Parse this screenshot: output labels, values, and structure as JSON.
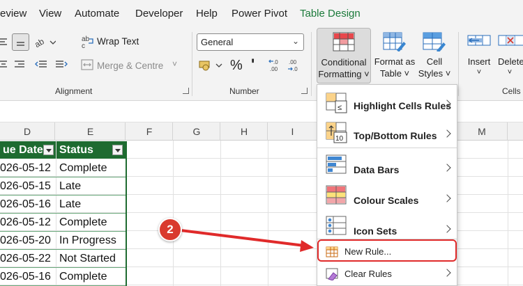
{
  "menu_tabs": [
    {
      "label": "eview"
    },
    {
      "label": "View"
    },
    {
      "label": "Automate"
    },
    {
      "label": "Developer"
    },
    {
      "label": "Help"
    },
    {
      "label": "Power Pivot"
    },
    {
      "label": "Table Design"
    }
  ],
  "ribbon": {
    "alignment": {
      "wrap_text": "Wrap Text",
      "merge_centre": "Merge & Centre",
      "group_label": "Alignment"
    },
    "number": {
      "format_value": "General",
      "percent_symbol": "%",
      "comma_symbol": "'",
      "increase_decimal": "←.0\n.00",
      "decrease_decimal": ".00\n→.0",
      "group_label": "Number"
    },
    "styles": {
      "conditional_formatting": [
        "Conditional",
        "Formatting ˅"
      ],
      "format_as_table": [
        "Format as",
        "Table ˅"
      ],
      "cell_styles": [
        "Cell",
        "Styles ˅"
      ]
    },
    "cells": {
      "insert": "Insert",
      "delete": "Delete",
      "group_label": "Cells"
    }
  },
  "grid": {
    "column_headers": [
      "D",
      "E",
      "F",
      "G",
      "H",
      "I",
      "M"
    ],
    "table_headers": [
      "ue Date",
      "Status"
    ],
    "rows": [
      {
        "due": "026-05-12",
        "status": "Complete"
      },
      {
        "due": "026-05-15",
        "status": "Late"
      },
      {
        "due": "026-05-16",
        "status": "Late"
      },
      {
        "due": "026-05-12",
        "status": "Complete"
      },
      {
        "due": "026-05-20",
        "status": "In Progress"
      },
      {
        "due": "026-05-22",
        "status": "Not Started"
      },
      {
        "due": "026-05-16",
        "status": "Complete"
      }
    ]
  },
  "cf_menu": {
    "items": [
      {
        "label": "Highlight Cells Rules",
        "icon": "highlight-cells-icon"
      },
      {
        "label": "Top/Bottom Rules",
        "icon": "top-bottom-icon"
      },
      {
        "label": "Data Bars",
        "icon": "data-bars-icon"
      },
      {
        "label": "Colour Scales",
        "icon": "colour-scales-icon"
      },
      {
        "label": "Icon Sets",
        "icon": "icon-sets-icon"
      },
      {
        "label": "New Rule...",
        "icon": "new-rule-icon"
      },
      {
        "label": "Clear Rules",
        "icon": "clear-rules-icon"
      }
    ]
  },
  "annotation": {
    "step": "2"
  },
  "colors": {
    "table_header": "#1e6b30",
    "active_tab": "#1b7a3a",
    "highlight": "#e02a2a",
    "badge": "#d93a2e"
  }
}
